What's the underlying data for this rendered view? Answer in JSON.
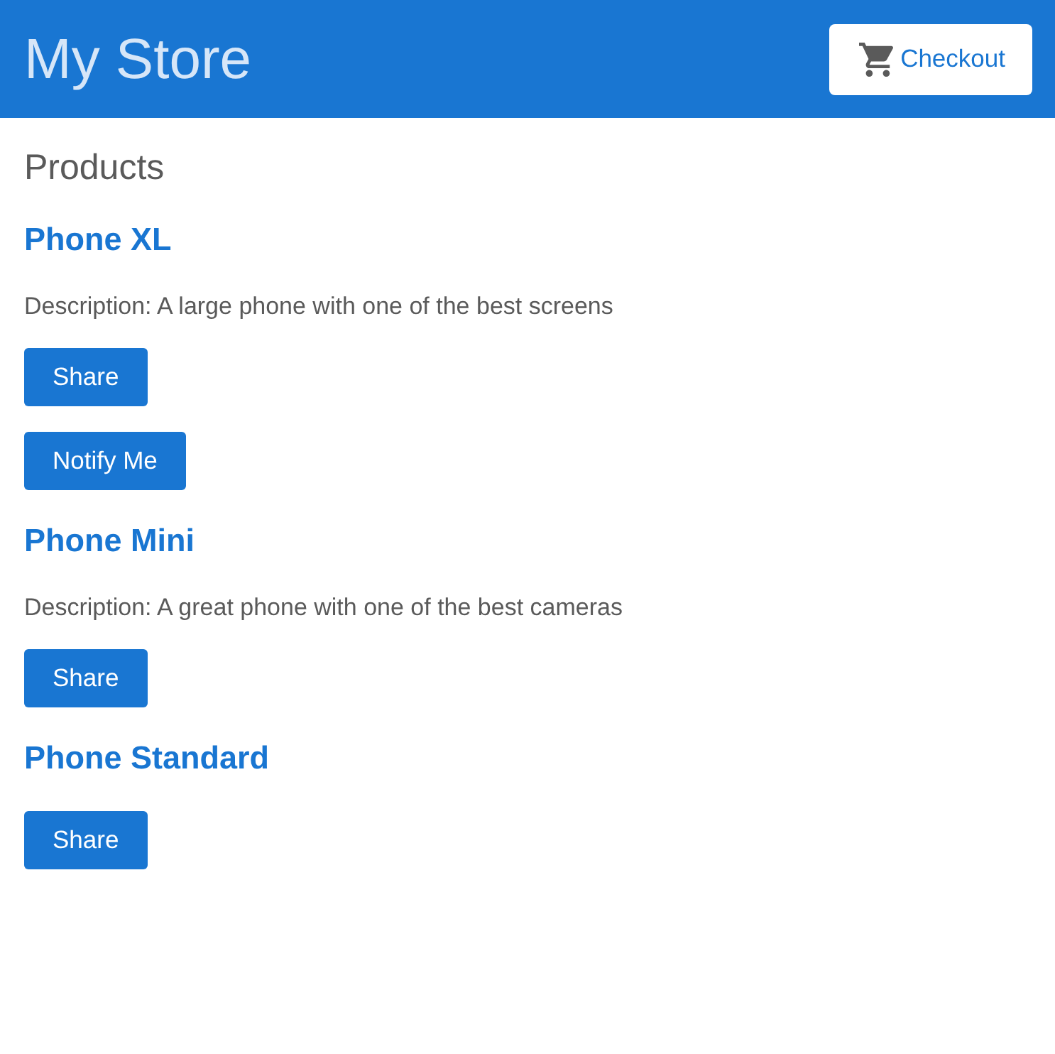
{
  "top_bar": {
    "title": "My Store",
    "checkout_button": {
      "label": "Checkout"
    }
  },
  "products_heading": "Products",
  "products": [
    {
      "name": "Phone XL",
      "description": "Description: A large phone with one of the best screens",
      "buttons": [
        "Share",
        "Notify Me"
      ]
    },
    {
      "name": "Phone Mini",
      "description": "Description: A great phone with one of the best cameras",
      "buttons": [
        "Share"
      ]
    },
    {
      "name": "Phone Standard",
      "buttons": [
        "Share"
      ]
    }
  ]
}
